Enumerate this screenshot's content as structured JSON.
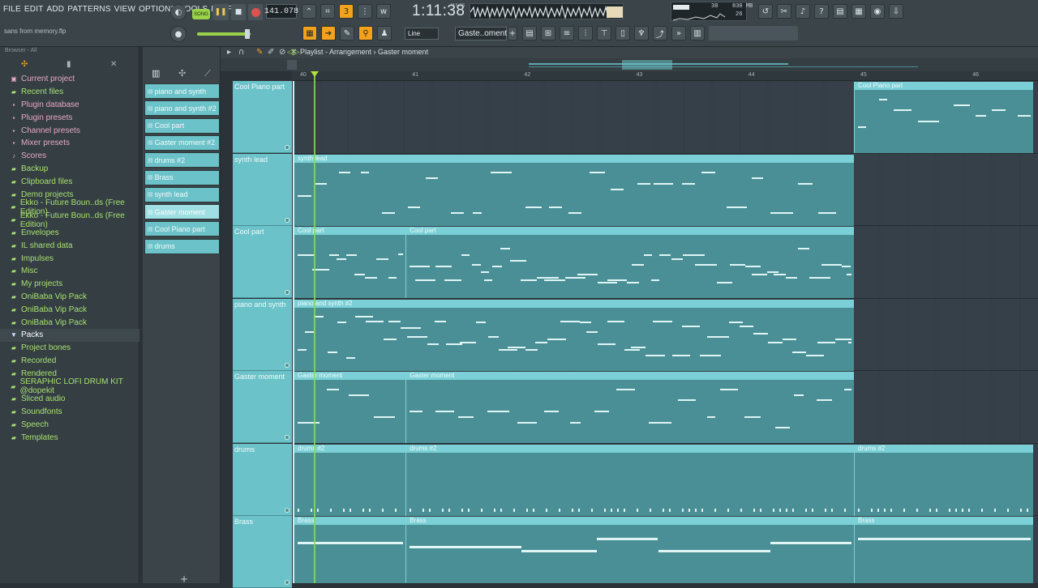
{
  "menu": [
    "FILE",
    "EDIT",
    "ADD",
    "PATTERNS",
    "VIEW",
    "OPTIONS",
    "TOOLS",
    "HELP"
  ],
  "project_name": "sans from memory.flp",
  "transport": {
    "song_label": "SONG",
    "tempo": "141.078",
    "time": "1:11:38",
    "time_unit": "M:S:CS"
  },
  "cpu": {
    "a": "38",
    "b": "830 MB",
    "c": "26"
  },
  "toolbar": {
    "snap": "Line",
    "pattern": "Gaste..oment"
  },
  "browser": {
    "header": "Browser - All",
    "items": [
      {
        "label": "Current project",
        "icon": "project-icon",
        "color": "#e8a8c8"
      },
      {
        "label": "Recent files",
        "icon": "folder-icon",
        "color": "#a8e070"
      },
      {
        "label": "Plugin database",
        "icon": "plug-icon",
        "color": "#e8a8c8"
      },
      {
        "label": "Plugin presets",
        "icon": "plug-icon",
        "color": "#e8a8c8"
      },
      {
        "label": "Channel presets",
        "icon": "channel-icon",
        "color": "#e8a8c8"
      },
      {
        "label": "Mixer presets",
        "icon": "mixer-icon",
        "color": "#e8a8c8"
      },
      {
        "label": "Scores",
        "icon": "note-icon",
        "color": "#e8a8c8"
      },
      {
        "label": "Backup",
        "icon": "folder-icon",
        "color": "#a8e070"
      },
      {
        "label": "Clipboard files",
        "icon": "folder-icon",
        "color": "#a8e070"
      },
      {
        "label": "Demo projects",
        "icon": "folder-icon",
        "color": "#a8e070"
      },
      {
        "label": "Ekko - Future Boun..ds (Free Edition)",
        "icon": "folder-icon",
        "color": "#a8e070"
      },
      {
        "label": "Ekko - Future Boun..ds (Free Edition)",
        "icon": "folder-icon",
        "color": "#a8e070"
      },
      {
        "label": "Envelopes",
        "icon": "folder-icon",
        "color": "#a8e070"
      },
      {
        "label": "IL shared data",
        "icon": "folder-icon",
        "color": "#a8e070"
      },
      {
        "label": "Impulses",
        "icon": "folder-icon",
        "color": "#a8e070"
      },
      {
        "label": "Misc",
        "icon": "folder-icon",
        "color": "#a8e070"
      },
      {
        "label": "My projects",
        "icon": "folder-icon",
        "color": "#a8e070"
      },
      {
        "label": "OniBaba Vip Pack",
        "icon": "folder-icon",
        "color": "#a8e070"
      },
      {
        "label": "OniBaba Vip Pack",
        "icon": "folder-icon",
        "color": "#a8e070"
      },
      {
        "label": "OniBaba Vip Pack",
        "icon": "folder-icon",
        "color": "#a8e070"
      },
      {
        "label": "Packs",
        "icon": "packs-icon",
        "color": "#cfe3ff",
        "selected": true
      },
      {
        "label": "Project bones",
        "icon": "folder-icon",
        "color": "#a8e070"
      },
      {
        "label": "Recorded",
        "icon": "folder-icon",
        "color": "#a8e070"
      },
      {
        "label": "Rendered",
        "icon": "folder-icon",
        "color": "#a8e070"
      },
      {
        "label": "SERAPHIC LOFI DRUM KIT @dopekit",
        "icon": "folder-icon",
        "color": "#a8e070"
      },
      {
        "label": "Sliced audio",
        "icon": "folder-icon",
        "color": "#a8e070"
      },
      {
        "label": "Soundfonts",
        "icon": "folder-icon",
        "color": "#a8e070"
      },
      {
        "label": "Speech",
        "icon": "folder-icon",
        "color": "#a8e070"
      },
      {
        "label": "Templates",
        "icon": "folder-icon",
        "color": "#a8e070"
      }
    ]
  },
  "patterns": [
    {
      "label": "piano and synth"
    },
    {
      "label": "piano and synth #2"
    },
    {
      "label": "Cool part"
    },
    {
      "label": "Gaster moment #2"
    },
    {
      "label": "drums #2"
    },
    {
      "label": "Brass"
    },
    {
      "label": "synth lead"
    },
    {
      "label": "Gaster moment",
      "active": true
    },
    {
      "label": "Cool Piano part"
    },
    {
      "label": "drums"
    }
  ],
  "playlist": {
    "title": "Playlist - Arrangement",
    "pattern": "Gaster moment",
    "ruler": [
      "40",
      "41",
      "42",
      "43",
      "44",
      "45",
      "46"
    ]
  },
  "tracks": [
    {
      "name": "Cool Piano part",
      "clips": [
        {
          "label": "Cool Piano part",
          "start": 45,
          "end": 46.6
        }
      ]
    },
    {
      "name": "synth lead",
      "clips": [
        {
          "label": "synth lead",
          "start": 40,
          "end": 45
        }
      ]
    },
    {
      "name": "Cool part",
      "clips": [
        {
          "label": "Cool part",
          "start": 40,
          "end": 41
        },
        {
          "label": "Cool part",
          "start": 41,
          "end": 45
        }
      ]
    },
    {
      "name": "piano and synth",
      "clips": [
        {
          "label": "piano and synth #2",
          "start": 40,
          "end": 45
        }
      ]
    },
    {
      "name": "Gaster moment",
      "clips": [
        {
          "label": "Gaster moment",
          "start": 40,
          "end": 41
        },
        {
          "label": "Gaster moment",
          "start": 41,
          "end": 45
        }
      ]
    },
    {
      "name": "drums",
      "clips": [
        {
          "label": "drums #2",
          "start": 40,
          "end": 41
        },
        {
          "label": "drums #2",
          "start": 41,
          "end": 45
        },
        {
          "label": "drums #2",
          "start": 45,
          "end": 46.6
        }
      ]
    },
    {
      "name": "Brass",
      "clips": [
        {
          "label": "Brass",
          "start": 40,
          "end": 41
        },
        {
          "label": "Brass",
          "start": 41,
          "end": 45
        },
        {
          "label": "Brass",
          "start": 45,
          "end": 46.6
        }
      ]
    }
  ],
  "colors": {
    "clip": "#7ad0d6",
    "accent": "#f3a21a",
    "playhead": "#86d95b"
  }
}
